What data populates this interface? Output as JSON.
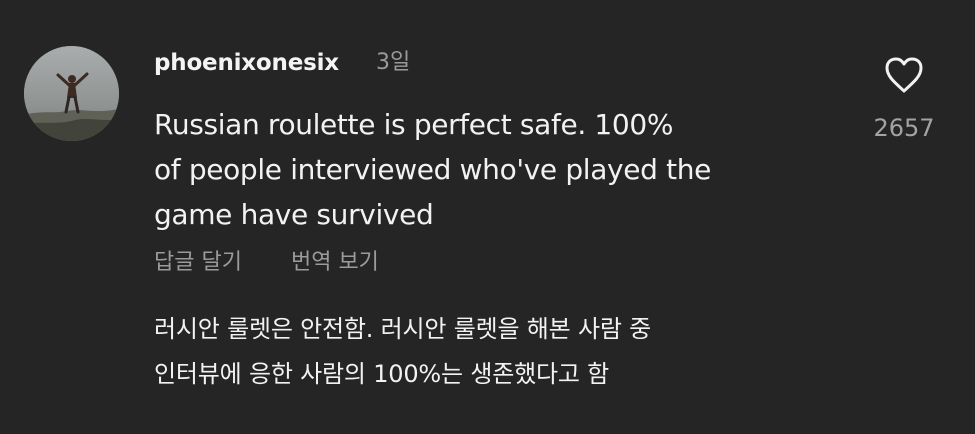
{
  "comment": {
    "username": "phoenixonesix",
    "time": "3일",
    "text_lines": [
      "Russian roulette is perfect safe. 100%",
      "of people interviewed who've played the",
      "game have survived"
    ],
    "actions": {
      "reply": "답글 달기",
      "translate": "번역 보기"
    },
    "translation_lines": [
      "러시안 룰렛은 안전함. 러시안 룰렛을 해본 사람 중",
      "인터뷰에 응한 사람의 100%는 생존했다고 함"
    ],
    "likes": "2657",
    "icons": {
      "like": "heart-icon"
    }
  },
  "colors": {
    "background": "#252525",
    "primary_text": "#f2f2f2",
    "secondary_text": "#9b9b9b"
  }
}
